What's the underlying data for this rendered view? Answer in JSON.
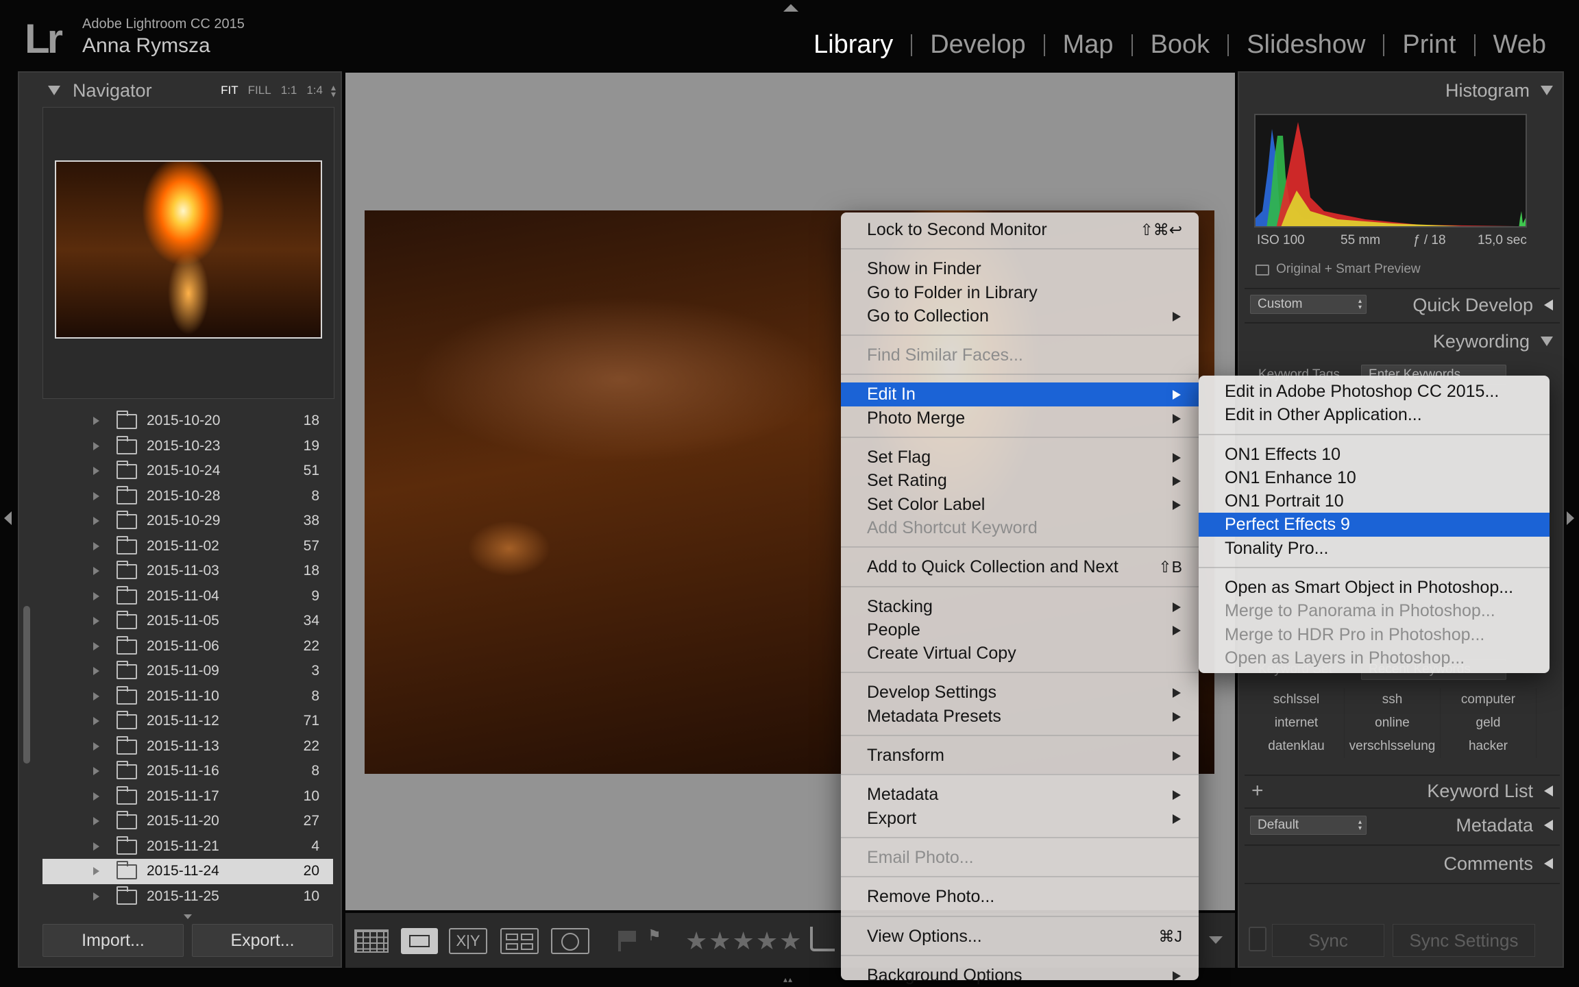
{
  "header": {
    "logo": "Lr",
    "app_title": "Adobe Lightroom CC 2015",
    "user_name": "Anna Rymsza",
    "modules": [
      "Library",
      "Develop",
      "Map",
      "Book",
      "Slideshow",
      "Print",
      "Web"
    ],
    "active_module": "Library"
  },
  "navigator": {
    "title": "Navigator",
    "zoom_options": [
      "FIT",
      "FILL",
      "1:1",
      "1:4"
    ],
    "active_zoom": "FIT"
  },
  "folders": [
    {
      "name": "2015-10-20",
      "count": "18"
    },
    {
      "name": "2015-10-23",
      "count": "19"
    },
    {
      "name": "2015-10-24",
      "count": "51"
    },
    {
      "name": "2015-10-28",
      "count": "8"
    },
    {
      "name": "2015-10-29",
      "count": "38"
    },
    {
      "name": "2015-11-02",
      "count": "57"
    },
    {
      "name": "2015-11-03",
      "count": "18"
    },
    {
      "name": "2015-11-04",
      "count": "9"
    },
    {
      "name": "2015-11-05",
      "count": "34"
    },
    {
      "name": "2015-11-06",
      "count": "22"
    },
    {
      "name": "2015-11-09",
      "count": "3"
    },
    {
      "name": "2015-11-10",
      "count": "8"
    },
    {
      "name": "2015-11-12",
      "count": "71"
    },
    {
      "name": "2015-11-13",
      "count": "22"
    },
    {
      "name": "2015-11-16",
      "count": "8"
    },
    {
      "name": "2015-11-17",
      "count": "10"
    },
    {
      "name": "2015-11-20",
      "count": "27"
    },
    {
      "name": "2015-11-21",
      "count": "4"
    },
    {
      "name": "2015-11-24",
      "count": "20",
      "selected": true
    },
    {
      "name": "2015-11-25",
      "count": "10"
    }
  ],
  "left_buttons": {
    "import": "Import...",
    "export": "Export..."
  },
  "histogram": {
    "title": "Histogram",
    "iso": "ISO 100",
    "focal": "55 mm",
    "aperture": "ƒ / 18",
    "shutter": "15,0 sec",
    "preview_status": "Original + Smart Preview"
  },
  "quick_develop": {
    "title": "Quick Develop",
    "preset": "Custom"
  },
  "keywording": {
    "title": "Keywording",
    "keyword_tags_label": "Keyword Tags",
    "keyword_tags_value": "Enter Keywords",
    "keyword_set_label": "Keyword Set",
    "keyword_set_value": "Recent Keywords",
    "keywords": [
      "schlssel",
      "ssh",
      "computer",
      "internet",
      "online",
      "geld",
      "datenklau",
      "verschlsselung",
      "hacker"
    ]
  },
  "keyword_list": {
    "title": "Keyword List",
    "add": "+"
  },
  "metadata_panel": {
    "title": "Metadata",
    "preset": "Default"
  },
  "comments": {
    "title": "Comments"
  },
  "sync": {
    "sync": "Sync",
    "sync_settings": "Sync Settings"
  },
  "toolbar": {
    "stars": "★★★★★",
    "xy": "X|Y"
  },
  "context_menu": {
    "groups": [
      [
        {
          "label": "Lock to Second Monitor",
          "shortcut": "⇧⌘↩"
        }
      ],
      [
        {
          "label": "Show in Finder"
        },
        {
          "label": "Go to Folder in Library"
        },
        {
          "label": "Go to Collection",
          "submenu": true
        }
      ],
      [
        {
          "label": "Find Similar Faces...",
          "disabled": true
        }
      ],
      [
        {
          "label": "Edit In",
          "submenu": true,
          "highlighted": true
        },
        {
          "label": "Photo Merge",
          "submenu": true
        }
      ],
      [
        {
          "label": "Set Flag",
          "submenu": true
        },
        {
          "label": "Set Rating",
          "submenu": true
        },
        {
          "label": "Set Color Label",
          "submenu": true
        },
        {
          "label": "Add Shortcut Keyword",
          "disabled": true
        }
      ],
      [
        {
          "label": "Add to Quick Collection and Next",
          "shortcut": "⇧B"
        }
      ],
      [
        {
          "label": "Stacking",
          "submenu": true
        },
        {
          "label": "People",
          "submenu": true
        },
        {
          "label": "Create Virtual Copy"
        }
      ],
      [
        {
          "label": "Develop Settings",
          "submenu": true
        },
        {
          "label": "Metadata Presets",
          "submenu": true
        }
      ],
      [
        {
          "label": "Transform",
          "submenu": true
        }
      ],
      [
        {
          "label": "Metadata",
          "submenu": true
        },
        {
          "label": "Export",
          "submenu": true
        }
      ],
      [
        {
          "label": "Email Photo...",
          "disabled": true
        }
      ],
      [
        {
          "label": "Remove Photo..."
        }
      ],
      [
        {
          "label": "View Options...",
          "shortcut": "⌘J"
        }
      ],
      [
        {
          "label": "Background Options",
          "submenu": true
        }
      ]
    ]
  },
  "edit_in_submenu": {
    "groups": [
      [
        {
          "label": "Edit in Adobe Photoshop CC 2015..."
        },
        {
          "label": "Edit in Other Application..."
        }
      ],
      [
        {
          "label": "ON1 Effects 10"
        },
        {
          "label": "ON1 Enhance 10"
        },
        {
          "label": "ON1 Portrait 10"
        },
        {
          "label": "Perfect Effects 9",
          "highlighted": true
        },
        {
          "label": "Tonality Pro..."
        }
      ],
      [
        {
          "label": "Open as Smart Object in Photoshop..."
        },
        {
          "label": "Merge to Panorama in Photoshop...",
          "disabled": true
        },
        {
          "label": "Merge to HDR Pro in Photoshop...",
          "disabled": true
        },
        {
          "label": "Open as Layers in Photoshop...",
          "disabled": true
        }
      ]
    ]
  }
}
